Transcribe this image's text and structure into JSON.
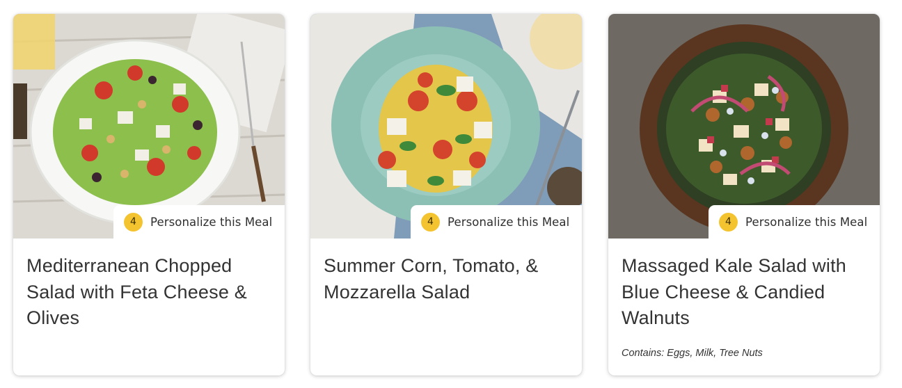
{
  "cards": [
    {
      "image": "mediterranean-chopped-salad-photo",
      "badge_count": "4",
      "badge_label": "Personalize this Meal",
      "title": "Mediterranean Chopped Salad with Feta Cheese & Olives",
      "contains": ""
    },
    {
      "image": "summer-corn-tomato-mozzarella-salad-photo",
      "badge_count": "4",
      "badge_label": "Personalize this Meal",
      "title": "Summer Corn, Tomato, & Mozzarella Salad",
      "contains": ""
    },
    {
      "image": "massaged-kale-salad-photo",
      "badge_count": "4",
      "badge_label": "Personalize this Meal",
      "title": "Massaged Kale Salad with Blue Cheese & Candied Walnuts",
      "contains": "Contains: Eggs, Milk, Tree Nuts"
    }
  ],
  "colors": {
    "badge_circle": "#f4c430",
    "card_background": "#ffffff",
    "text": "#333333"
  }
}
